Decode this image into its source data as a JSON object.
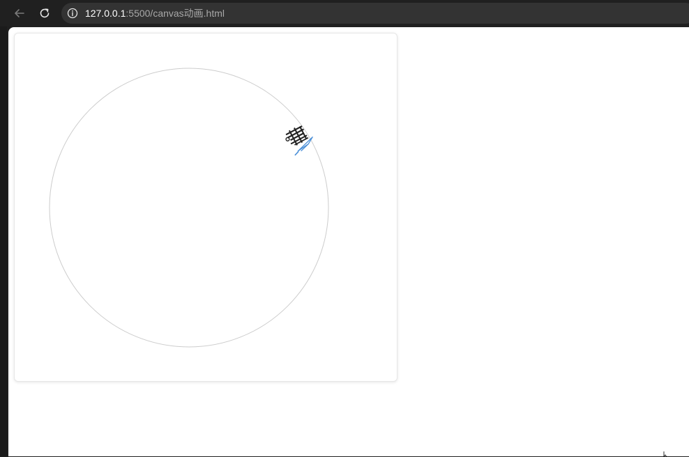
{
  "browser": {
    "url_host": "127.0.0.1",
    "url_path": ":5500/canvas动画.html",
    "icons": {
      "back": "arrow-left-icon",
      "reload": "reload-icon",
      "site_info": "info-icon"
    }
  },
  "page": {
    "background": "#ffffff",
    "canvas": {
      "scene": "circle orbit animation",
      "circle_stroke": "#cccccc",
      "sprite": {
        "name": "airplane",
        "stroke": "#4a8fd8",
        "glyph_color": "#222222"
      }
    }
  }
}
